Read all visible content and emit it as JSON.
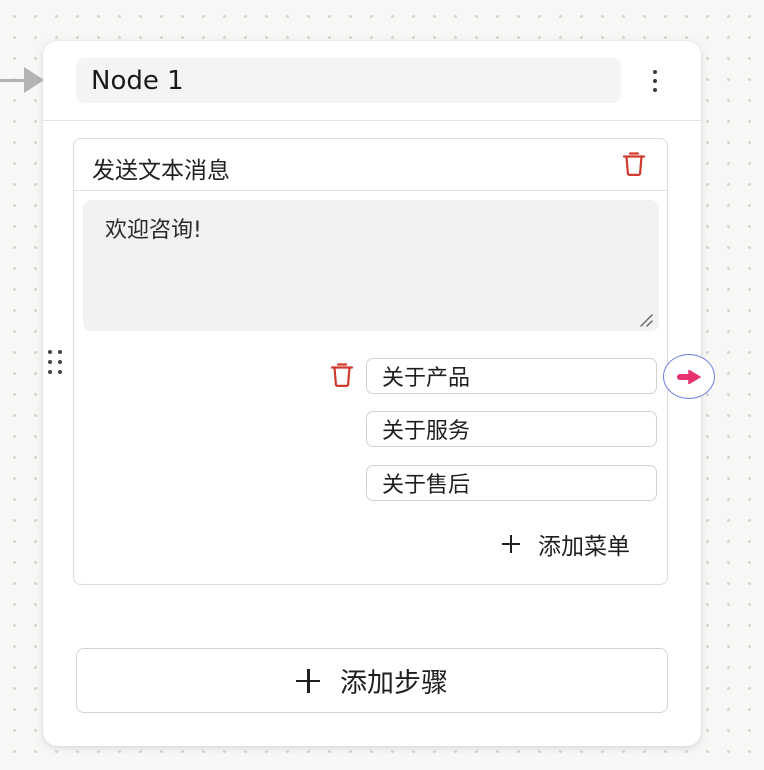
{
  "node": {
    "title": "Node 1"
  },
  "step": {
    "title": "发送文本消息",
    "message": "欢迎咨询!",
    "options": [
      {
        "label": "关于产品"
      },
      {
        "label": "关于服务"
      },
      {
        "label": "关于售后"
      }
    ],
    "add_menu_label": "添加菜单"
  },
  "add_step_label": "添加步骤",
  "icons": {
    "more": "more-vertical-icon",
    "delete": "trash-icon",
    "drag": "drag-handle-icon",
    "add": "plus-icon",
    "connector": "arrow-right-icon",
    "resize": "resize-handle-icon"
  },
  "colors": {
    "danger": "#d03a2f",
    "connector_border": "#6b7ee0",
    "connector_arrow": "#e6336e",
    "edge": "#b3b3b3"
  }
}
